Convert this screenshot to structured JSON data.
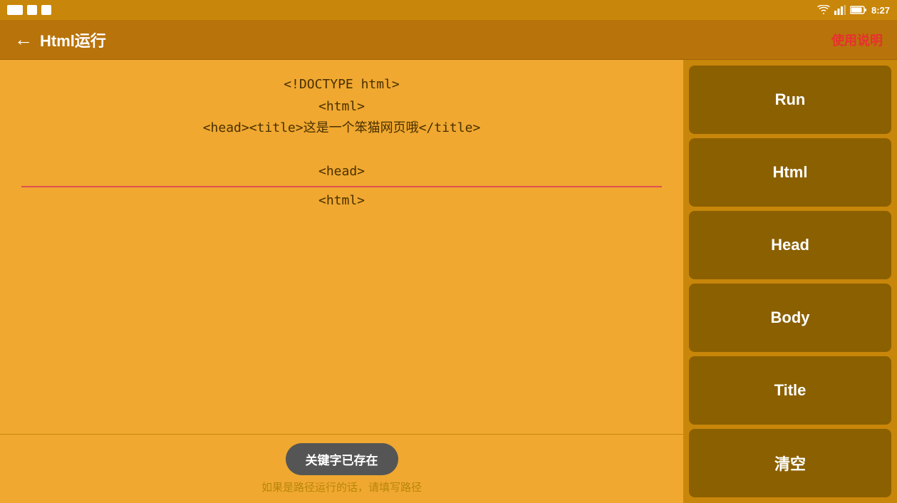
{
  "statusBar": {
    "time": "8:27"
  },
  "topBar": {
    "backLabel": "←",
    "title": "Html运行",
    "helpLabel": "使用说明"
  },
  "codeEditor": {
    "lines": [
      "<!DOCTYPE html>",
      "<html>",
      "<head><title>这是一个笨猫网页哦</title>",
      "",
      "<head>",
      "<html>"
    ]
  },
  "sidebar": {
    "buttons": [
      {
        "label": "Run"
      },
      {
        "label": "Html"
      },
      {
        "label": "Head"
      },
      {
        "label": "Body"
      },
      {
        "label": "Title"
      },
      {
        "label": "清空"
      }
    ]
  },
  "bottomBar": {
    "badge": "关键字已存在",
    "hint": "如果是路径运行的话，请填写路径"
  }
}
